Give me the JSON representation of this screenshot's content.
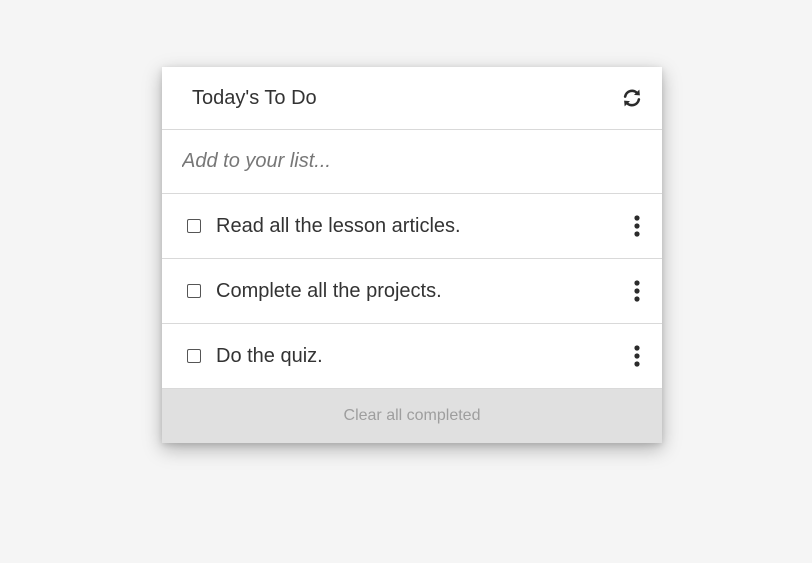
{
  "header": {
    "title": "Today's To Do",
    "refresh_icon": "refresh-icon"
  },
  "add": {
    "placeholder": "Add to your list..."
  },
  "todos": [
    {
      "text": "Read all the lesson articles.",
      "checked": false,
      "menu_icon": "more-vertical-icon"
    },
    {
      "text": "Complete all the projects.",
      "checked": false,
      "menu_icon": "more-vertical-icon"
    },
    {
      "text": "Do the quiz.",
      "checked": false,
      "menu_icon": "more-vertical-icon"
    }
  ],
  "footer": {
    "clear_label": "Clear all completed"
  },
  "colors": {
    "background": "#f5f5f5",
    "card": "#ffffff",
    "footer_bg": "#e0e0e0",
    "footer_text": "#9e9e9e",
    "text": "#333333"
  }
}
